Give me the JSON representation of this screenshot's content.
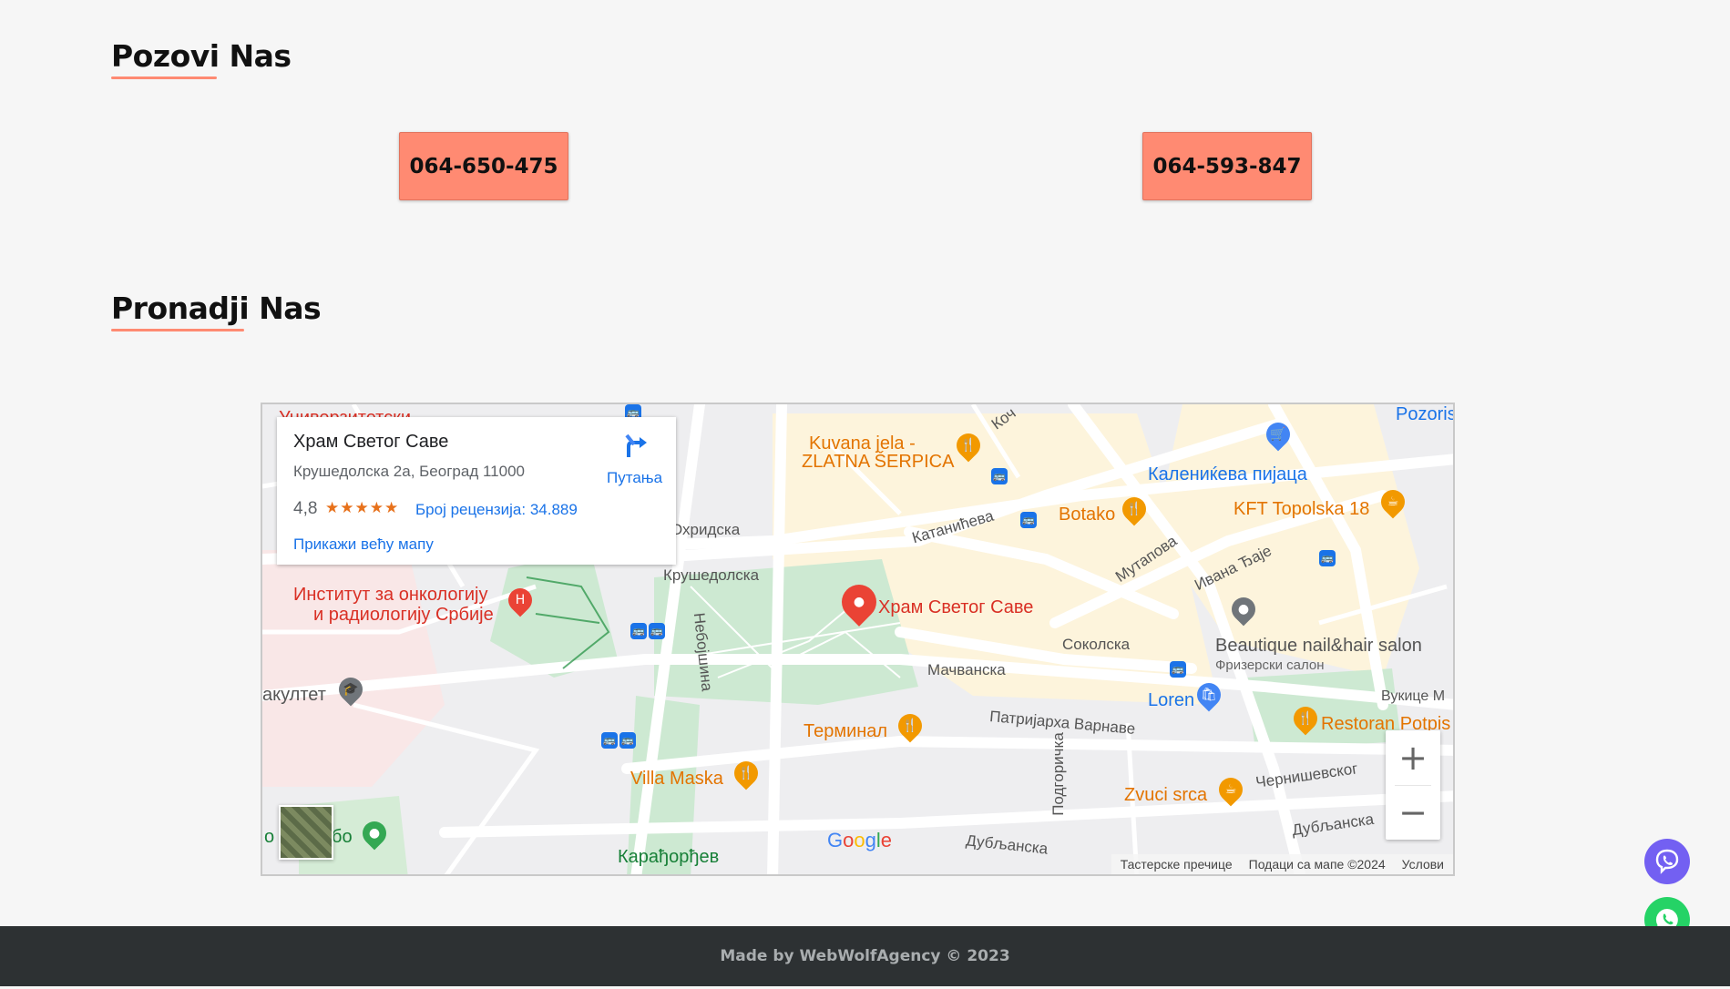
{
  "call_section": {
    "title": "Pozovi Nas",
    "phones": [
      "064-650-475",
      "064-593-847"
    ]
  },
  "find_section": {
    "title": "Pronadji Nas"
  },
  "map": {
    "place_card": {
      "name": "Храм Светог Саве",
      "address": "Крушедолска 2а, Београд 11000",
      "rating": "4,8",
      "stars": "★★★★★",
      "reviews": "Број рецензија: 34.889",
      "bigger_map": "Прикажи већу мапу",
      "directions": "Путања"
    },
    "labels": {
      "marker": "Храм Светог Саве",
      "kuvana1": "Kuvana jela -",
      "kuvana2": "ZLATNA ŠERPICA",
      "kalenic": "Калениќева пијаца",
      "botako": "Botako",
      "kft": "KFT Topolska 18",
      "institut1": "Институт за онкологију",
      "institut2": "и радиологију Србије",
      "fakultet": "акултет",
      "terminal": "Терминал",
      "villa": "Villa Maska",
      "karadjordjev": "Карађорђев",
      "beautique": "Beautique nail&hair salon",
      "frizerski": "Фризерски салон",
      "loren": "Loren",
      "restoran": "Restoran Potpis",
      "zvuci": "Zvuci srca",
      "pozoris": "Pozoris",
      "univerzitetski": "Универзитетски",
      "oparking": "о",
      "bo": "бо",
      "vukice": "Вукице М"
    },
    "streets": {
      "ohridska": "Охридска",
      "krusedolska": "Крушедолска",
      "katanicheva": "Катанићева",
      "mutapova": "Мутапова",
      "ivana": "Ивана Ђаје",
      "sokolska": "Соколска",
      "macvanska": "Мачванска",
      "patrijarha": "Патријарха Варнаве",
      "cernisevskog": "Чернишевског",
      "dubljanska1": "Дубљанска",
      "dubljanska2": "Дубљанска",
      "podgoricka": "Подгоричка",
      "nebojsina": "Небојшина",
      "koc": "Коч"
    },
    "google": "Google",
    "attribution": [
      "Тастерске пречице",
      "Подаци са мапе ©2024",
      "Услови"
    ],
    "zoom_in": "+",
    "zoom_out": "−"
  },
  "footer": {
    "text": "Made by WebWolfAgency © 2023"
  },
  "colors": {
    "accent": "#ff8a72",
    "footer_bg": "#2d3133",
    "viber": "#7360f2",
    "whatsapp": "#25d366"
  },
  "icons": [
    "viber-icon",
    "whatsapp-icon",
    "directions-icon",
    "map-marker-icon"
  ]
}
